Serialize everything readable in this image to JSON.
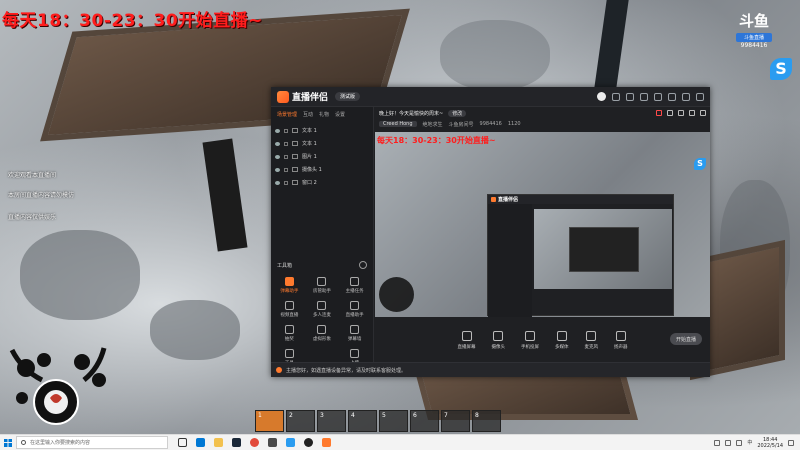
{
  "overlay": {
    "title": "每天18：30-23：30开始直播~",
    "side_notes": [
      "欢迎观看本直播间",
      "本房间直播内容请勿模仿",
      "直播内容仅供娱乐"
    ],
    "douyu_mark": "斗鱼",
    "douyu_sub": "斗鱼直播",
    "room_number": "9984416"
  },
  "app": {
    "name": "直播伴侣",
    "badge": "测试版",
    "scene_tabs": [
      "场景管理",
      "互动",
      "礼物",
      "设置"
    ],
    "sources": [
      "文本 1",
      "文本 1",
      "图片 1",
      "摄像头 1",
      "窗口 2"
    ],
    "tools_title": "工具箱",
    "tools": [
      {
        "label": "弹幕助手",
        "hot": true
      },
      {
        "label": "房管助手",
        "hot": false
      },
      {
        "label": "主播任务",
        "hot": false
      },
      {
        "label": "视频直播",
        "hot": false
      },
      {
        "label": "多人连麦",
        "hot": false
      },
      {
        "label": "直播助手",
        "hot": false
      },
      {
        "label": "抽奖",
        "hot": false
      },
      {
        "label": "虚拟形象",
        "hot": false
      },
      {
        "label": "弹幕墙",
        "hot": false
      },
      {
        "label": "工具",
        "hot": false
      },
      {
        "label": "",
        "hot": false
      },
      {
        "label": "上传",
        "hot": false
      }
    ],
    "room_title": "晚上好！今天是愉快的周末~",
    "room_tag": "修改",
    "streamer_name": "Creed Hong",
    "meta_items": [
      "绝地求生",
      "斗鱼房间号",
      "9984416",
      "1120"
    ],
    "preview_title": "每天18：30-23：30开始直播~",
    "nested_title": "直播伴侣",
    "controls": [
      "直播屏幕",
      "摄像头",
      "手机投屏",
      "多媒体",
      "麦克风",
      "扬声器"
    ],
    "go_live_label": "开始直播",
    "notice": "主播您好，如遇直播设备异常，请及时联系客服处理。"
  },
  "hotbar": [
    "1",
    "2",
    "3",
    "4",
    "5",
    "6",
    "7",
    "8"
  ],
  "taskbar": {
    "search_placeholder": "在这里输入你要搜索的内容",
    "time": "18:44",
    "date": "2022/5/14",
    "lang": "中"
  },
  "colors": {
    "accent": "#ff7a2e",
    "title_red": "#ff1d1d",
    "douyu_blue": "#2a9cf0"
  }
}
